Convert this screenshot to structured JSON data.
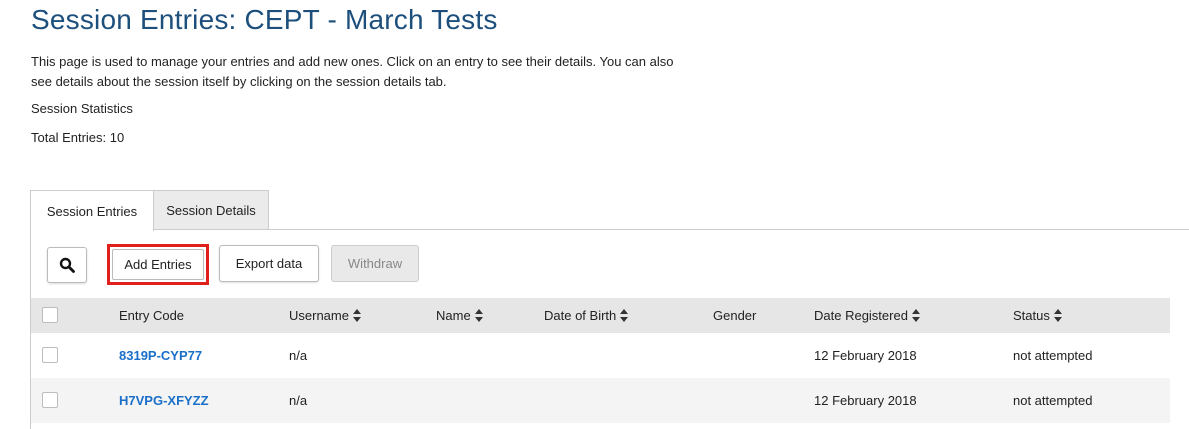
{
  "page": {
    "title": "Session Entries: CEPT - March Tests",
    "intro": "This page is used to manage your entries and add new ones. Click on an entry to see their details. You can also see details about the session itself by clicking on the session details tab.",
    "stats_label": "Session Statistics",
    "total_entries": "Total Entries: 10"
  },
  "tabs": [
    {
      "label": "Session Entries",
      "active": true
    },
    {
      "label": "Session Details",
      "active": false
    }
  ],
  "toolbar": {
    "search_icon": "search-icon",
    "add_label": "Add Entries",
    "export_label": "Export data",
    "withdraw_label": "Withdraw",
    "highlight_color": "#e0201b"
  },
  "table": {
    "columns": [
      "Entry Code",
      "Username",
      "Name",
      "Date of Birth",
      "Gender",
      "Date Registered",
      "Status"
    ],
    "rows": [
      {
        "entry_code": "8319P-CYP77",
        "username": "n/a",
        "name": "",
        "dob": "",
        "gender": "",
        "registered": "12 February 2018",
        "status": "not attempted"
      },
      {
        "entry_code": "H7VPG-XFYZZ",
        "username": "n/a",
        "name": "",
        "dob": "",
        "gender": "",
        "registered": "12 February 2018",
        "status": "not attempted"
      }
    ]
  },
  "colors": {
    "title": "#1d4f7c",
    "link": "#1a6fc9",
    "header_bg": "#e6e6e6"
  }
}
